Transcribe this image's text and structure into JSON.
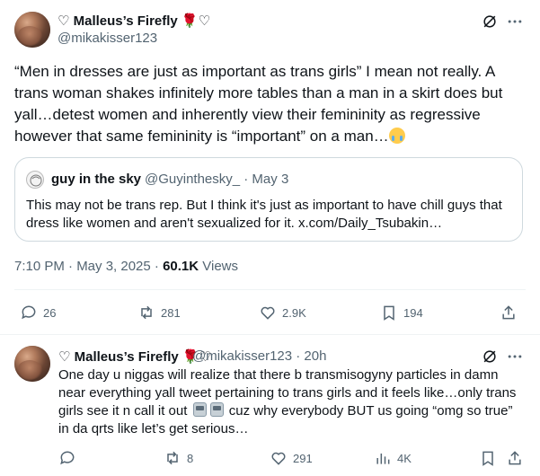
{
  "main_tweet": {
    "display_name": "♡ Malleus’s Firefly 🌹♡",
    "handle": "@mikakisser123",
    "text": "“Men in dresses are just as important as trans girls” I mean not really. A trans woman shakes infinitely more tables than a man in a skirt does but yall…detest women and inherently view their femininity as regressive however that same femininity is “important” on a man…",
    "emoji": "loudly-crying-face",
    "timestamp": "7:10 PM · May 3, 2025 · ",
    "views_count": "60.1K",
    "views_label": " Views",
    "actions": {
      "replies": "26",
      "reposts": "281",
      "likes": "2.9K",
      "bookmarks": "194"
    }
  },
  "quoted_tweet": {
    "display_name": "guy in the sky",
    "handle": "@Guyinthesky_ · May 3",
    "text": "This may not be trans rep. But I think it's just as important to have chill guys that dress like women and aren't sexualized for it. x.com/Daily_Tsubakin…"
  },
  "reply_tweet": {
    "display_name": "♡ Malleus’s Firefly 🌹♡",
    "handle": "@mikakisser123 · 20h",
    "text_before_emoji": "One day u niggas will realize that there b transmisogyny particles in damn near everything yall tweet pertaining to trans girls and it feels like…only trans girls see it n call it out",
    "text_after_emoji": "cuz why everybody BUT us going “omg so true” in da qrts like let’s get serious…",
    "actions": {
      "replies": "",
      "reposts": "8",
      "likes": "291",
      "views": "4K"
    }
  },
  "colors": {
    "text_primary": "#0f1419",
    "text_secondary": "#536471",
    "border": "#cfd9de",
    "divider": "#eff3f4"
  }
}
